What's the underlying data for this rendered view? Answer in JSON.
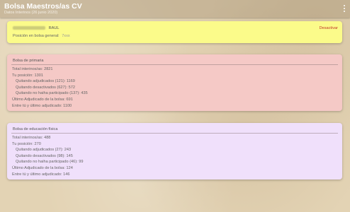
{
  "app": {
    "title": "Bolsa Maestros/as CV",
    "subtitle": "Datos Interinos (26 junio 2020)",
    "menu_icon": "more-vert-icon"
  },
  "user": {
    "name": "RAUL",
    "subscribe_label": "Desactivar",
    "position_label": "Posición en bolsa general:",
    "position_value": "7xxx"
  },
  "lists": [
    {
      "title": "Bolsa de primaria",
      "color": "#f5c9c6",
      "rows": [
        {
          "text": "Total interinos/as: 2821",
          "indent": false
        },
        {
          "text": "Tu posición: 1301",
          "indent": false
        },
        {
          "text": "Quitando adjudicados (121): 1169",
          "indent": true
        },
        {
          "text": "Quitando desactivados (627): 572",
          "indent": true
        },
        {
          "text": "Quitando no haiha participado (137): 435",
          "indent": true
        },
        {
          "text": "Último Adjudicado de la bolsa: 691",
          "indent": false
        },
        {
          "text": "Entre tú y último adjudicado: 1100",
          "indent": false
        }
      ]
    },
    {
      "title": "Bolsa de educación física",
      "color": "#f0e0fb",
      "rows": [
        {
          "text": "Total interinos/as: 488",
          "indent": false
        },
        {
          "text": "Tu posición: 270",
          "indent": false
        },
        {
          "text": "Quitando adjudicados (27): 243",
          "indent": true
        },
        {
          "text": "Quitando desactivados (98): 145",
          "indent": true
        },
        {
          "text": "Quitando no haiha participado (46): 99",
          "indent": true
        },
        {
          "text": "Último Adjudicado de la bolsa: 124",
          "indent": false
        },
        {
          "text": "Entre tú y último adjudicado: 146",
          "indent": false
        }
      ]
    }
  ]
}
